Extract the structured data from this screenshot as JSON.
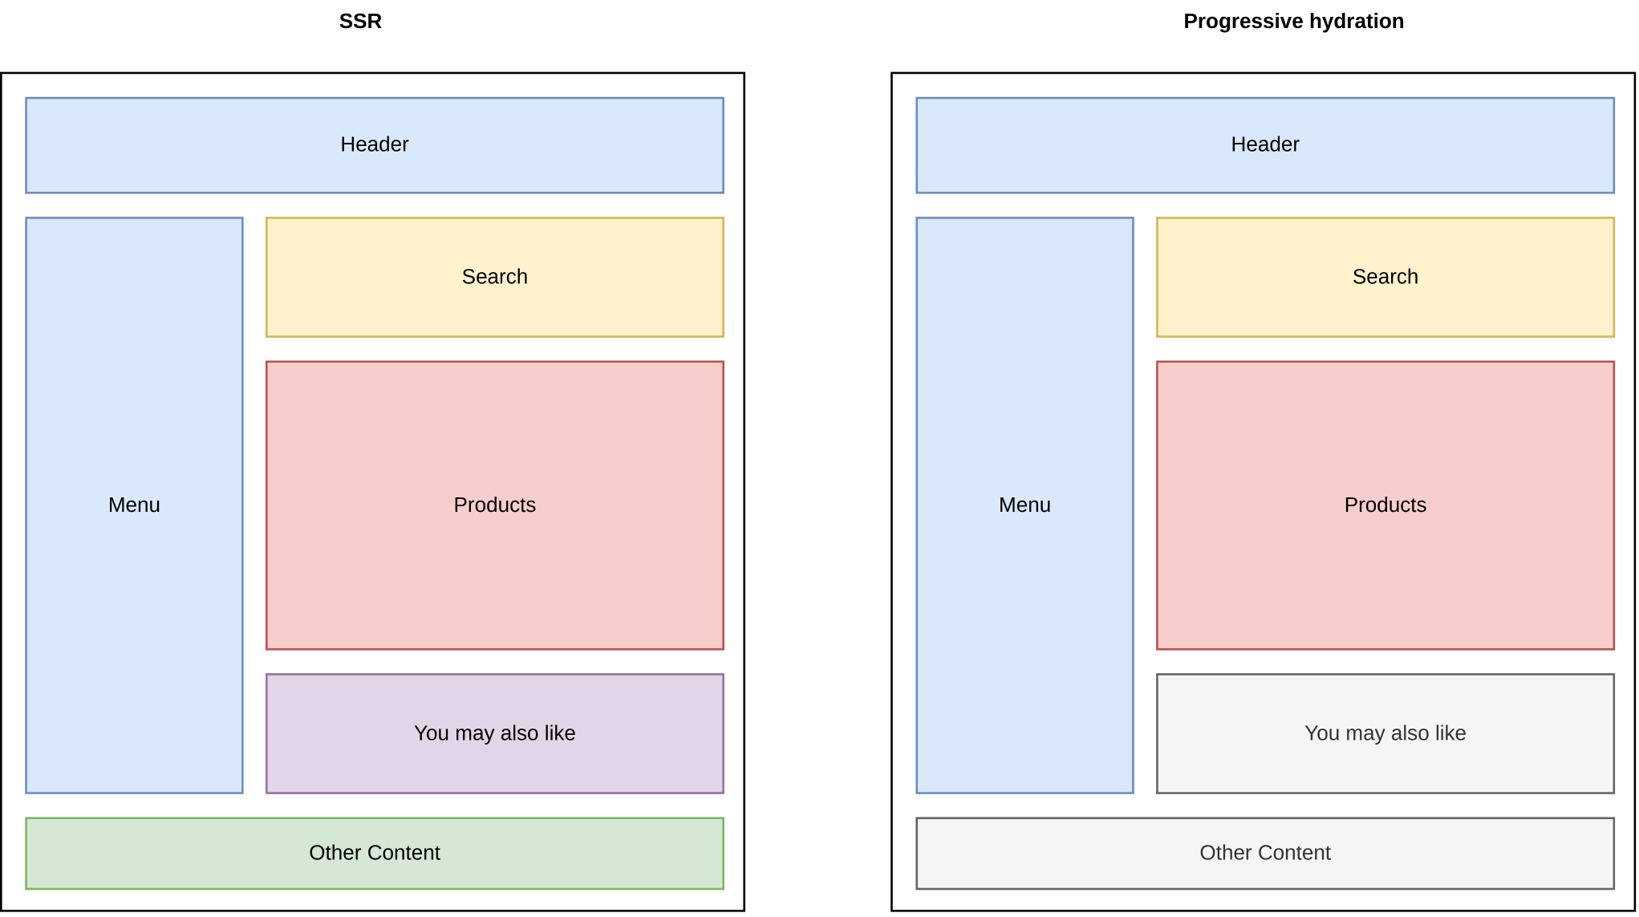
{
  "panels": [
    {
      "title": "SSR",
      "header": "Header",
      "menu": "Menu",
      "search": "Search",
      "products": "Products",
      "also_like": "You may also like",
      "other": "Other Content"
    },
    {
      "title": "Progressive hydration",
      "header": "Header",
      "menu": "Menu",
      "search": "Search",
      "products": "Products",
      "also_like": "You may also like",
      "other": "Other Content"
    }
  ],
  "colors": {
    "blue_fill": "#dae8fc",
    "blue_stroke": "#6c8ebf",
    "yellow_fill": "#fff2cc",
    "yellow_stroke": "#d6b656",
    "red_fill": "#f8cecc",
    "red_stroke": "#b85450",
    "purple_fill": "#e1d5e7",
    "purple_stroke": "#9673a6",
    "green_fill": "#d5e8d4",
    "green_stroke": "#82b366",
    "gray_fill": "#f5f5f5",
    "gray_stroke": "#666666"
  }
}
